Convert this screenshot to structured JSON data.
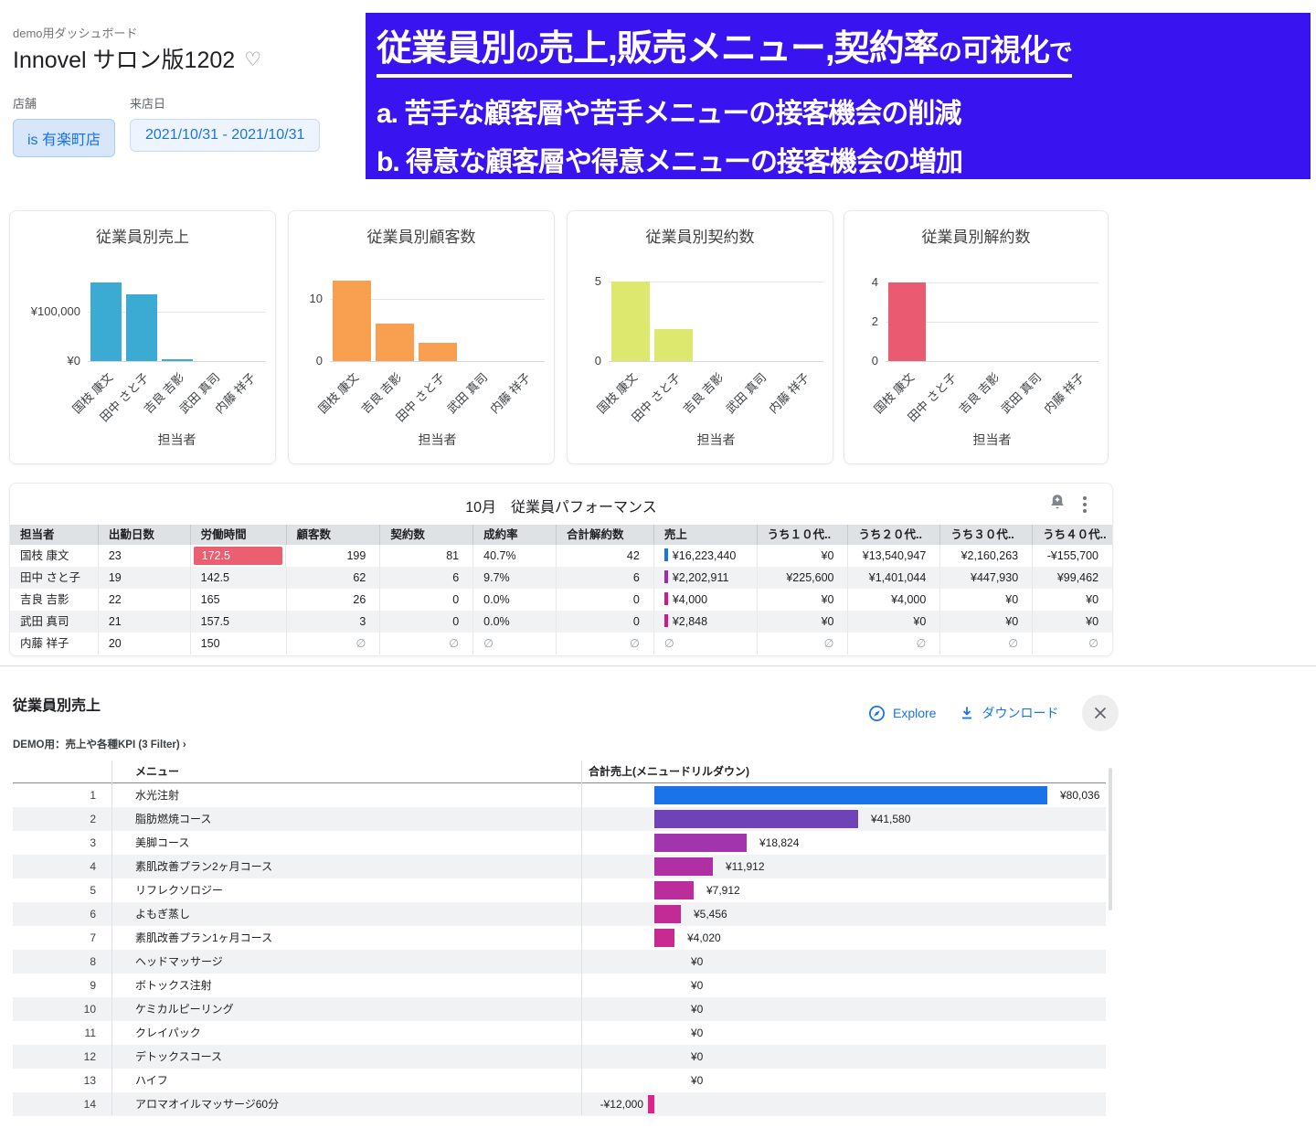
{
  "header": {
    "subtitle": "demo用ダッシュボード",
    "title": "Innovel サロン版1202",
    "favorite_icon": "heart-outline",
    "store_filter": {
      "label": "店舗",
      "value": "is 有楽町店"
    },
    "date_filter": {
      "label": "来店日",
      "value": "2021/10/31 - 2021/10/31"
    }
  },
  "banner": {
    "bg_color": "#3a14f0",
    "title_segments": [
      {
        "text": "従業員別",
        "size": "lg"
      },
      {
        "text": "の",
        "size": "sm"
      },
      {
        "text": "売上,販売メニュー,契約率",
        "size": "lg"
      },
      {
        "text": "の",
        "size": "sm"
      },
      {
        "text": "可視化",
        "size": "md"
      },
      {
        "text": "で",
        "size": "sm"
      }
    ],
    "line_a": "a. 苦手な顧客層や苦手メニューの接客機会の削減",
    "line_b": "b. 得意な顧客層や得意メニューの接客機会の増加"
  },
  "charts": [
    {
      "title": "従業員別売上",
      "xlabel": "担当者",
      "bar_color": "#3BABD3",
      "ymax": 192000,
      "ticks": [
        {
          "label": "¥100,000",
          "value": 100000
        },
        {
          "label": "¥0",
          "value": 0
        }
      ],
      "categories": [
        "国枝 康文",
        "田中 さと子",
        "吉良 吉影",
        "武田 真司",
        "内藤 祥子"
      ],
      "values": [
        158000,
        134000,
        4000,
        0,
        0
      ]
    },
    {
      "title": "従業員別顧客数",
      "xlabel": "担当者",
      "bar_color": "#F9A050",
      "ymax": 15.3,
      "ticks": [
        {
          "label": "10",
          "value": 10
        },
        {
          "label": "0",
          "value": 0
        }
      ],
      "categories": [
        "国枝 康文",
        "吉良 吉影",
        "田中 さと子",
        "武田 真司",
        "内藤 祥子"
      ],
      "values": [
        13,
        6,
        3,
        0,
        0
      ]
    },
    {
      "title": "従業員別契約数",
      "xlabel": "担当者",
      "bar_color": "#DCE96E",
      "ymax": 6,
      "ticks": [
        {
          "label": "5",
          "value": 5
        },
        {
          "label": "0",
          "value": 0
        }
      ],
      "categories": [
        "国枝 康文",
        "田中 さと子",
        "吉良 吉影",
        "武田 真司",
        "内藤 祥子"
      ],
      "values": [
        5,
        2,
        0,
        0,
        0
      ]
    },
    {
      "title": "従業員別解約数",
      "xlabel": "担当者",
      "bar_color": "#EA5B71",
      "ymax": 4.84,
      "ticks": [
        {
          "label": "4",
          "value": 4
        },
        {
          "label": "2",
          "value": 2
        },
        {
          "label": "0",
          "value": 0
        }
      ],
      "categories": [
        "国枝 康文",
        "田中 さと子",
        "吉良 吉影",
        "武田 真司",
        "内藤 祥子"
      ],
      "values": [
        4,
        0,
        0,
        0,
        0
      ]
    }
  ],
  "performance_table": {
    "title": "10月　従業員パフォーマンス",
    "icons": [
      "alarm-add-icon",
      "kebab-menu-icon"
    ],
    "columns": [
      "担当者",
      "出勤日数",
      "労働時間",
      "顧客数",
      "契約数",
      "成約率",
      "合計解約数",
      "売上",
      "うち１０代..",
      "うち２０代..",
      "うち３０代..",
      "うち４０代.."
    ],
    "rows": [
      [
        "国枝 康文",
        "23",
        "172.5",
        "199",
        "81",
        "40.7%",
        "42",
        "¥16,223,440",
        "¥0",
        "¥13,540,947",
        "¥2,160,263",
        "-¥155,700"
      ],
      [
        "田中 さと子",
        "19",
        "142.5",
        "62",
        "6",
        "9.7%",
        "6",
        "¥2,202,911",
        "¥225,600",
        "¥1,401,044",
        "¥447,930",
        "¥99,462"
      ],
      [
        "吉良 吉影",
        "22",
        "165",
        "26",
        "0",
        "0.0%",
        "0",
        "¥4,000",
        "¥0",
        "¥4,000",
        "¥0",
        "¥0"
      ],
      [
        "武田 真司",
        "21",
        "157.5",
        "3",
        "0",
        "0.0%",
        "0",
        "¥2,848",
        "¥0",
        "¥0",
        "¥0",
        "¥0"
      ],
      [
        "内藤 祥子",
        "20",
        "150",
        "∅",
        "∅",
        "∅",
        "∅",
        "∅",
        "∅",
        "∅",
        "∅",
        "∅"
      ]
    ],
    "highlight_cell": {
      "row": 0,
      "col": 2,
      "color": "#ec5f70"
    },
    "sales_bar_colors": [
      "#1a73e8",
      "#9c2bb5",
      "#d4188c",
      "#d4188c",
      null
    ]
  },
  "drilldown": {
    "title": "従業員別売上",
    "explore_label": "Explore",
    "download_label": "ダウンロード",
    "breadcrumb": "DEMO用：売上や各種KPI (3 Filter) ›",
    "columns": {
      "menu": "メニュー",
      "value": "合計売上(メニュードリルダウン)"
    },
    "max_value": 80036,
    "rows": [
      {
        "rank": "1",
        "menu": "水光注射",
        "label": "¥80,036",
        "value": 80036,
        "color": "#1a73e8"
      },
      {
        "rank": "2",
        "menu": "脂肪燃焼コース",
        "label": "¥41,580",
        "value": 41580,
        "color": "#6f42b8"
      },
      {
        "rank": "3",
        "menu": "美脚コース",
        "label": "¥18,824",
        "value": 18824,
        "color": "#a234ae"
      },
      {
        "rank": "4",
        "menu": "素肌改善プラン2ヶ月コース",
        "label": "¥11,912",
        "value": 11912,
        "color": "#b02fa4"
      },
      {
        "rank": "5",
        "menu": "リフレクソロジー",
        "label": "¥7,912",
        "value": 7912,
        "color": "#bb2d9d"
      },
      {
        "rank": "6",
        "menu": "よもぎ蒸し",
        "label": "¥5,456",
        "value": 5456,
        "color": "#c22b96"
      },
      {
        "rank": "7",
        "menu": "素肌改善プラン1ヶ月コース",
        "label": "¥4,020",
        "value": 4020,
        "color": "#c92a91"
      },
      {
        "rank": "8",
        "menu": "ヘッドマッサージ",
        "label": "¥0",
        "value": 0,
        "color": null
      },
      {
        "rank": "9",
        "menu": "ボトックス注射",
        "label": "¥0",
        "value": 0,
        "color": null
      },
      {
        "rank": "10",
        "menu": "ケミカルピーリング",
        "label": "¥0",
        "value": 0,
        "color": null
      },
      {
        "rank": "11",
        "menu": "クレイパック",
        "label": "¥0",
        "value": 0,
        "color": null
      },
      {
        "rank": "12",
        "menu": "デトックスコース",
        "label": "¥0",
        "value": 0,
        "color": null
      },
      {
        "rank": "13",
        "menu": "ハイフ",
        "label": "¥0",
        "value": 0,
        "color": null
      },
      {
        "rank": "14",
        "menu": "アロマオイルマッサージ60分",
        "label": "-¥12,000",
        "value": -12000,
        "color": "#e4218b"
      }
    ]
  },
  "chart_data": [
    {
      "type": "bar",
      "title": "従業員別売上",
      "xlabel": "担当者",
      "categories": [
        "国枝 康文",
        "田中 さと子",
        "吉良 吉影",
        "武田 真司",
        "内藤 祥子"
      ],
      "values": [
        158000,
        134000,
        4000,
        0,
        0
      ],
      "ylim": [
        0,
        192000
      ],
      "grid": true
    },
    {
      "type": "bar",
      "title": "従業員別顧客数",
      "xlabel": "担当者",
      "categories": [
        "国枝 康文",
        "吉良 吉影",
        "田中 さと子",
        "武田 真司",
        "内藤 祥子"
      ],
      "values": [
        13,
        6,
        3,
        0,
        0
      ],
      "ylim": [
        0,
        15
      ],
      "grid": true
    },
    {
      "type": "bar",
      "title": "従業員別契約数",
      "xlabel": "担当者",
      "categories": [
        "国枝 康文",
        "田中 さと子",
        "吉良 吉影",
        "武田 真司",
        "内藤 祥子"
      ],
      "values": [
        5,
        2,
        0,
        0,
        0
      ],
      "ylim": [
        0,
        6
      ],
      "grid": true
    },
    {
      "type": "bar",
      "title": "従業員別解約数",
      "xlabel": "担当者",
      "categories": [
        "国枝 康文",
        "田中 さと子",
        "吉良 吉影",
        "武田 真司",
        "内藤 祥子"
      ],
      "values": [
        4,
        0,
        0,
        0,
        0
      ],
      "ylim": [
        0,
        4.8
      ],
      "grid": true
    },
    {
      "type": "bar",
      "title": "合計売上(メニュードリルダウン)",
      "categories": [
        "水光注射",
        "脂肪燃焼コース",
        "美脚コース",
        "素肌改善プラン2ヶ月コース",
        "リフレクソロジー",
        "よもぎ蒸し",
        "素肌改善プラン1ヶ月コース",
        "ヘッドマッサージ",
        "ボトックス注射",
        "ケミカルピーリング",
        "クレイパック",
        "デトックスコース",
        "ハイフ",
        "アロマオイルマッサージ60分"
      ],
      "values": [
        80036,
        41580,
        18824,
        11912,
        7912,
        5456,
        4020,
        0,
        0,
        0,
        0,
        0,
        0,
        -12000
      ]
    }
  ]
}
